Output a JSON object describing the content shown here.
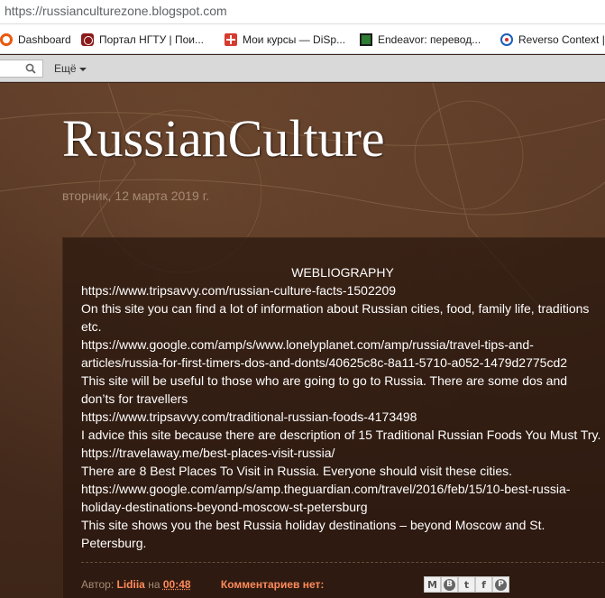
{
  "browser": {
    "url": "https://russianculturezone.blogspot.com",
    "bookmarks": [
      {
        "label": "Dashboard",
        "icon": "dashboard-icon"
      },
      {
        "label": "Портал НГТУ | Пои...",
        "icon": "ngtu-icon"
      },
      {
        "label": "Мои курсы — DiSp...",
        "icon": "courses-icon"
      },
      {
        "label": "Endeavor: перевод...",
        "icon": "endeavor-icon"
      },
      {
        "label": "Reverso Context |",
        "icon": "reverso-icon"
      }
    ]
  },
  "navbar": {
    "more_label": "Ещё"
  },
  "blog": {
    "title": "RussianCulture",
    "date": "вторник, 12 марта 2019 г."
  },
  "post": {
    "heading": "WEBLIOGRAPHY",
    "lines": [
      "https://www.tripsavvy.com/russian-culture-facts-1502209",
      "On this site you can find a lot of information about Russian cities, food, family life, traditions etc.",
      "https://www.google.com/amp/s/www.lonelyplanet.com/amp/russia/travel-tips-and-articles/russia-for-first-timers-dos-and-donts/40625c8c-8a11-5710-a052-1479d2775cd2",
      "This site will be useful to those who are going to go to Russia. There are some dos and don’ts for travellers",
      "https://www.tripsavvy.com/traditional-russian-foods-4173498",
      "I advice this site because there are description of 15 Traditional Russian Foods You Must Try.",
      "https://travelaway.me/best-places-visit-russia/",
      "There are 8 Best Places To Visit in Russia. Everyone should visit these cities.",
      "https://www.google.com/amp/s/amp.theguardian.com/travel/2016/feb/15/10-best-russia-holiday-destinations-beyond-moscow-st-petersburg",
      "This site shows you the best Russia holiday destinations – beyond Moscow and St. Petersburg."
    ],
    "footer": {
      "author_prefix": "Автор:",
      "author": "Lidiia",
      "time_prefix": "на",
      "time": "00:48",
      "comments": "Комментариев нет:"
    },
    "share_buttons": [
      {
        "label": "M",
        "icon": "gmail-icon"
      },
      {
        "label": "B",
        "icon": "blogger-icon"
      },
      {
        "label": "t",
        "icon": "twitter-icon"
      },
      {
        "label": "f",
        "icon": "facebook-icon"
      },
      {
        "label": "P",
        "icon": "pinterest-icon"
      }
    ]
  }
}
